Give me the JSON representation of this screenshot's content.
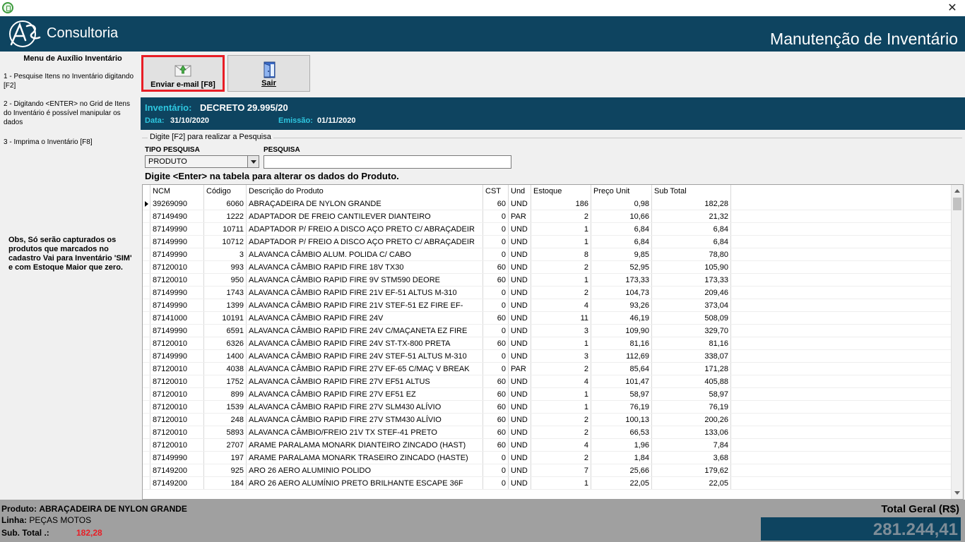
{
  "header": {
    "company": "Consultoria",
    "title": "Manutenção de Inventário"
  },
  "left_panel": {
    "title": "Menu de Auxílio Inventário",
    "steps": [
      "1 - Pesquise Itens no Inventário digitando [F2]",
      "2 - Digitando <ENTER> no Grid de Itens do Inventário é possível manipular os dados",
      "3 - Imprima o Inventário [F8]"
    ],
    "note": "Obs, Só serão capturados os produtos que marcados no cadastro Vai para Inventário 'SIM' e com Estoque Maior que zero."
  },
  "toolbar": {
    "email_label": "Enviar e-mail [F8]",
    "exit_label": "Sair"
  },
  "inventory": {
    "label": "Inventário:",
    "value": "DECRETO 29.995/20",
    "date_label": "Data:",
    "date_value": "31/10/2020",
    "emission_label": "Emissão:",
    "emission_value": "01/11/2020"
  },
  "search": {
    "legend": "Digite [F2] para realizar a Pesquisa",
    "type_label": "TIPO PESQUISA",
    "type_value": "PRODUTO",
    "search_label": "PESQUISA",
    "search_value": "",
    "hint": "Digite <Enter> na tabela para alterar os dados do Produto."
  },
  "grid": {
    "columns": [
      "NCM",
      "Código",
      "Descrição do Produto",
      "CST",
      "Und",
      "Estoque",
      "Preço Unit",
      "Sub Total"
    ],
    "rows": [
      [
        "39269090",
        "6060",
        "ABRAÇADEIRA DE NYLON GRANDE",
        "60",
        "UND",
        "186",
        "0,98",
        "182,28"
      ],
      [
        "87149490",
        "1222",
        "ADAPTADOR DE FREIO CANTILEVER DIANTEIRO",
        "0",
        "PAR",
        "2",
        "10,66",
        "21,32"
      ],
      [
        "87149990",
        "10711",
        "ADAPTADOR P/ FREIO A DISCO AÇO PRETO C/ ABRAÇADEIR",
        "0",
        "UND",
        "1",
        "6,84",
        "6,84"
      ],
      [
        "87149990",
        "10712",
        "ADAPTADOR P/ FREIO A DISCO AÇO PRETO C/ ABRAÇADEIR",
        "0",
        "UND",
        "1",
        "6,84",
        "6,84"
      ],
      [
        "87149990",
        "3",
        "ALAVANCA CÂMBIO ALUM. POLIDA C/ CABO",
        "0",
        "UND",
        "8",
        "9,85",
        "78,80"
      ],
      [
        "87120010",
        "993",
        "ALAVANCA CÂMBIO RAPID FIRE  18V TX30",
        "60",
        "UND",
        "2",
        "52,95",
        "105,90"
      ],
      [
        "87120010",
        "950",
        "ALAVANCA CÂMBIO RAPID FIRE  9V STM590 DEORE",
        "60",
        "UND",
        "1",
        "173,33",
        "173,33"
      ],
      [
        "87149990",
        "1743",
        "ALAVANCA CÂMBIO RAPID FIRE 21V EF-51 ALTUS M-310",
        "0",
        "UND",
        "2",
        "104,73",
        "209,46"
      ],
      [
        "87149990",
        "1399",
        "ALAVANCA CÂMBIO RAPID FIRE 21V STEF-51 EZ FIRE EF-",
        "0",
        "UND",
        "4",
        "93,26",
        "373,04"
      ],
      [
        "87141000",
        "10191",
        "ALAVANCA CÂMBIO RAPID FIRE 24V",
        "60",
        "UND",
        "11",
        "46,19",
        "508,09"
      ],
      [
        "87149990",
        "6591",
        "ALAVANCA CÂMBIO RAPID FIRE 24V C/MAÇANETA EZ FIRE",
        "0",
        "UND",
        "3",
        "109,90",
        "329,70"
      ],
      [
        "87120010",
        "6326",
        "ALAVANCA CÂMBIO RAPID FIRE 24V ST-TX-800 PRETA",
        "60",
        "UND",
        "1",
        "81,16",
        "81,16"
      ],
      [
        "87149990",
        "1400",
        "ALAVANCA CÂMBIO RAPID FIRE 24V STEF-51 ALTUS M-310",
        "0",
        "UND",
        "3",
        "112,69",
        "338,07"
      ],
      [
        "87120010",
        "4038",
        "ALAVANCA CÂMBIO RAPID FIRE 27V EF-65 C/MAÇ V BREAK",
        "0",
        "PAR",
        "2",
        "85,64",
        "171,28"
      ],
      [
        "87120010",
        "1752",
        "ALAVANCA CÂMBIO RAPID FIRE 27V EF51 ALTUS",
        "60",
        "UND",
        "4",
        "101,47",
        "405,88"
      ],
      [
        "87120010",
        "899",
        "ALAVANCA CÂMBIO RAPID FIRE 27V EF51 EZ",
        "60",
        "UND",
        "1",
        "58,97",
        "58,97"
      ],
      [
        "87120010",
        "1539",
        "ALAVANCA CÂMBIO RAPID FIRE 27V SLM430 ALÍVIO",
        "60",
        "UND",
        "1",
        "76,19",
        "76,19"
      ],
      [
        "87120010",
        "248",
        "ALAVANCA CÂMBIO RAPID FIRE 27V STM430 ALÍVIO",
        "60",
        "UND",
        "2",
        "100,13",
        "200,26"
      ],
      [
        "87120010",
        "5893",
        "ALAVANCA CÂMBIO/FREIO 21V TX STEF-41 PRETO",
        "60",
        "UND",
        "2",
        "66,53",
        "133,06"
      ],
      [
        "87120010",
        "2707",
        "ARAME PARALAMA MONARK DIANTEIRO ZINCADO (HAST)",
        "60",
        "UND",
        "4",
        "1,96",
        "7,84"
      ],
      [
        "87149990",
        "197",
        "ARAME PARALAMA MONARK TRASEIRO ZINCADO (HASTE)",
        "0",
        "UND",
        "2",
        "1,84",
        "3,68"
      ],
      [
        "87149200",
        "925",
        "ARO 26 AERO ALUMINIO POLIDO",
        "0",
        "UND",
        "7",
        "25,66",
        "179,62"
      ],
      [
        "87149200",
        "184",
        "ARO 26 AERO ALUMÍNIO PRETO BRILHANTE ESCAPE 36F",
        "0",
        "UND",
        "1",
        "22,05",
        "22,05"
      ]
    ]
  },
  "footer": {
    "product_label": "Produto:",
    "product_value": "ABRAÇADEIRA DE NYLON GRANDE",
    "line_label": "Linha:",
    "line_value": "PEÇAS MOTOS",
    "subtotal_label": "Sub. Total .:",
    "subtotal_value": "182,28",
    "total_label": "Total Geral (R$)",
    "total_value": "281.244,41"
  },
  "colors": {
    "brand": "#0e4460",
    "accent": "#2ec7e0",
    "highlight": "#e81d25"
  },
  "icons": {
    "app": "app-icon",
    "close": "close-icon",
    "email": "email-icon",
    "exit": "exit-door-icon",
    "logo": "logo-icon"
  }
}
